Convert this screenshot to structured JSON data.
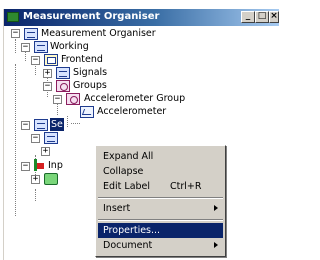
{
  "window": {
    "title": "Measurement Organiser",
    "controls": {
      "minimize": "_",
      "maximize": "□",
      "close": "×"
    }
  },
  "tree": {
    "root": "Measurement Organiser",
    "working": "Working",
    "frontend": "Frontend",
    "signals": "Signals",
    "groups": "Groups",
    "accel_group": "Accelerometer Group",
    "accelerometer": "Accelerometer",
    "selected_partial": "Se",
    "inputs_partial": "Inp",
    "expand_plus": "+",
    "expand_minus": "−"
  },
  "context_menu": {
    "expand_all": "Expand All",
    "collapse": "Collapse",
    "edit_label": "Edit Label",
    "edit_label_shortcut": "Ctrl+R",
    "insert": "Insert",
    "properties": "Properties...",
    "document": "Document"
  },
  "icons": {
    "app": "app-icon",
    "folder": "folder-icon",
    "group": "group-icon",
    "signal": "signal-icon",
    "input": "input-icon",
    "document": "document-icon"
  }
}
